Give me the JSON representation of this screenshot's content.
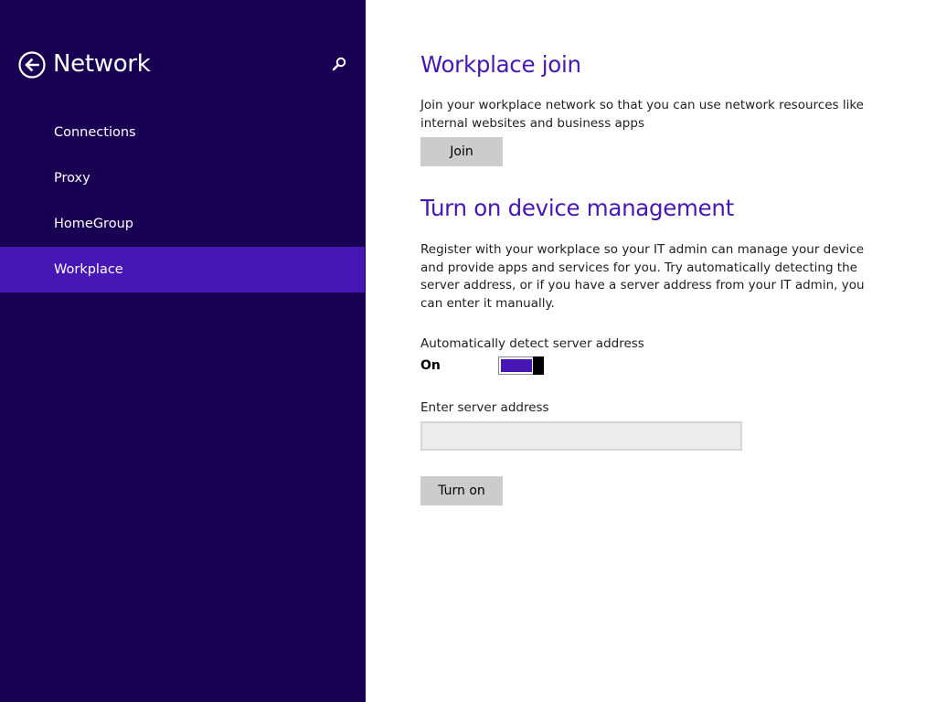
{
  "colors": {
    "sidebar_bg": "#180052",
    "accent": "#4617b4",
    "button_bg": "#cccccc"
  },
  "sidebar": {
    "back_icon": "back-arrow-circle-icon",
    "title": "Network",
    "search_icon": "search-icon",
    "items": [
      {
        "label": "Connections",
        "selected": false
      },
      {
        "label": "Proxy",
        "selected": false
      },
      {
        "label": "HomeGroup",
        "selected": false
      },
      {
        "label": "Workplace",
        "selected": true
      }
    ]
  },
  "workplace_join": {
    "title": "Workplace join",
    "description": "Join your workplace network so that you can use network resources like internal websites and business apps",
    "button_label": "Join"
  },
  "device_management": {
    "title": "Turn on device management",
    "description": "Register with your workplace so your IT admin can manage your device and provide apps and services for you. Try automatically detecting the server address, or if you have a server address from your IT admin, you can enter it manually.",
    "auto_detect_label": "Automatically detect server address",
    "auto_detect_state": "On",
    "auto_detect_on": true,
    "server_address_label": "Enter server address",
    "server_address_value": "",
    "button_label": "Turn on"
  }
}
